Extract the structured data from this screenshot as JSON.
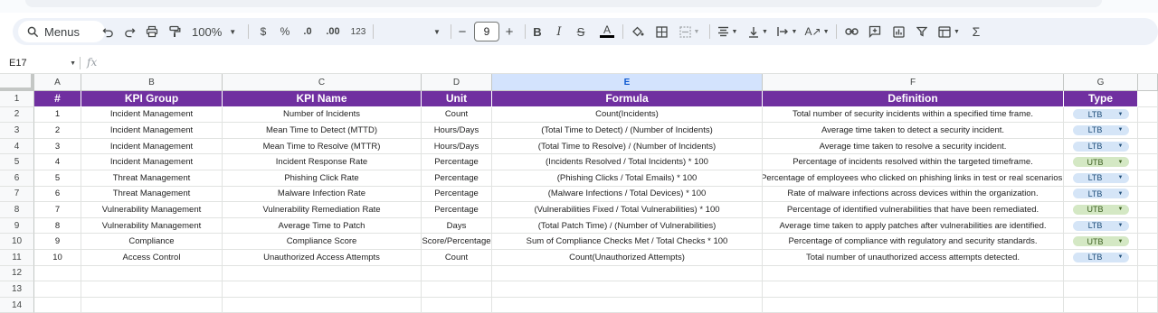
{
  "toolbar": {
    "menus_label": "Menus",
    "zoom": "100%",
    "currency": "$",
    "percent": "%",
    "dec_decrease": ".0",
    "dec_increase": ".00",
    "number_format": "123",
    "font_size": "9",
    "minus": "−",
    "plus": "+",
    "bold": "B",
    "italic": "I",
    "strike": "S",
    "text_color": "A"
  },
  "formula_bar": {
    "cell_ref": "E17",
    "fx": "fx"
  },
  "columns": [
    "A",
    "B",
    "C",
    "D",
    "E",
    "F",
    "G"
  ],
  "rows": [
    "1",
    "2",
    "3",
    "4",
    "5",
    "6",
    "7",
    "8",
    "9",
    "10",
    "11",
    "12",
    "13",
    "14"
  ],
  "header": [
    "#",
    "KPI Group",
    "KPI Name",
    "Unit",
    "Formula",
    "Definition",
    "Type"
  ],
  "data": [
    [
      "1",
      "Incident Management",
      "Number of Incidents",
      "Count",
      "Count(Incidents)",
      "Total number of security incidents within a specified time frame.",
      "LTB"
    ],
    [
      "2",
      "Incident Management",
      "Mean Time to Detect (MTTD)",
      "Hours/Days",
      "(Total Time to Detect) / (Number of Incidents)",
      "Average time taken to detect a security incident.",
      "LTB"
    ],
    [
      "3",
      "Incident Management",
      "Mean Time to Resolve (MTTR)",
      "Hours/Days",
      "(Total Time to Resolve) / (Number of Incidents)",
      "Average time taken to resolve a security incident.",
      "LTB"
    ],
    [
      "4",
      "Incident Management",
      "Incident Response Rate",
      "Percentage",
      "(Incidents Resolved / Total Incidents) * 100",
      "Percentage of incidents resolved within the targeted timeframe.",
      "UTB"
    ],
    [
      "5",
      "Threat Management",
      "Phishing Click Rate",
      "Percentage",
      "(Phishing Clicks / Total Emails) * 100",
      "Percentage of employees who clicked on phishing links in test or real scenarios.",
      "LTB"
    ],
    [
      "6",
      "Threat Management",
      "Malware Infection Rate",
      "Percentage",
      "(Malware Infections / Total Devices) * 100",
      "Rate of malware infections across devices within the organization.",
      "LTB"
    ],
    [
      "7",
      "Vulnerability Management",
      "Vulnerability Remediation Rate",
      "Percentage",
      "(Vulnerabilities Fixed / Total Vulnerabilities) * 100",
      "Percentage of identified vulnerabilities that have been remediated.",
      "UTB"
    ],
    [
      "8",
      "Vulnerability Management",
      "Average Time to Patch",
      "Days",
      "(Total Patch Time) / (Number of Vulnerabilities)",
      "Average time taken to apply patches after vulnerabilities are identified.",
      "LTB"
    ],
    [
      "9",
      "Compliance",
      "Compliance Score",
      "Score/Percentage",
      "Sum of Compliance Checks Met / Total Checks * 100",
      "Percentage of compliance with regulatory and security standards.",
      "UTB"
    ],
    [
      "10",
      "Access Control",
      "Unauthorized Access Attempts",
      "Count",
      "Count(Unauthorized Attempts)",
      "Total number of unauthorized access attempts detected.",
      "LTB"
    ]
  ],
  "colors": {
    "header_bg": "#7030a0",
    "ltb_chip": "#d5e5f7",
    "utb_chip": "#d4e8c4",
    "selected_col": "#d3e3fd"
  }
}
